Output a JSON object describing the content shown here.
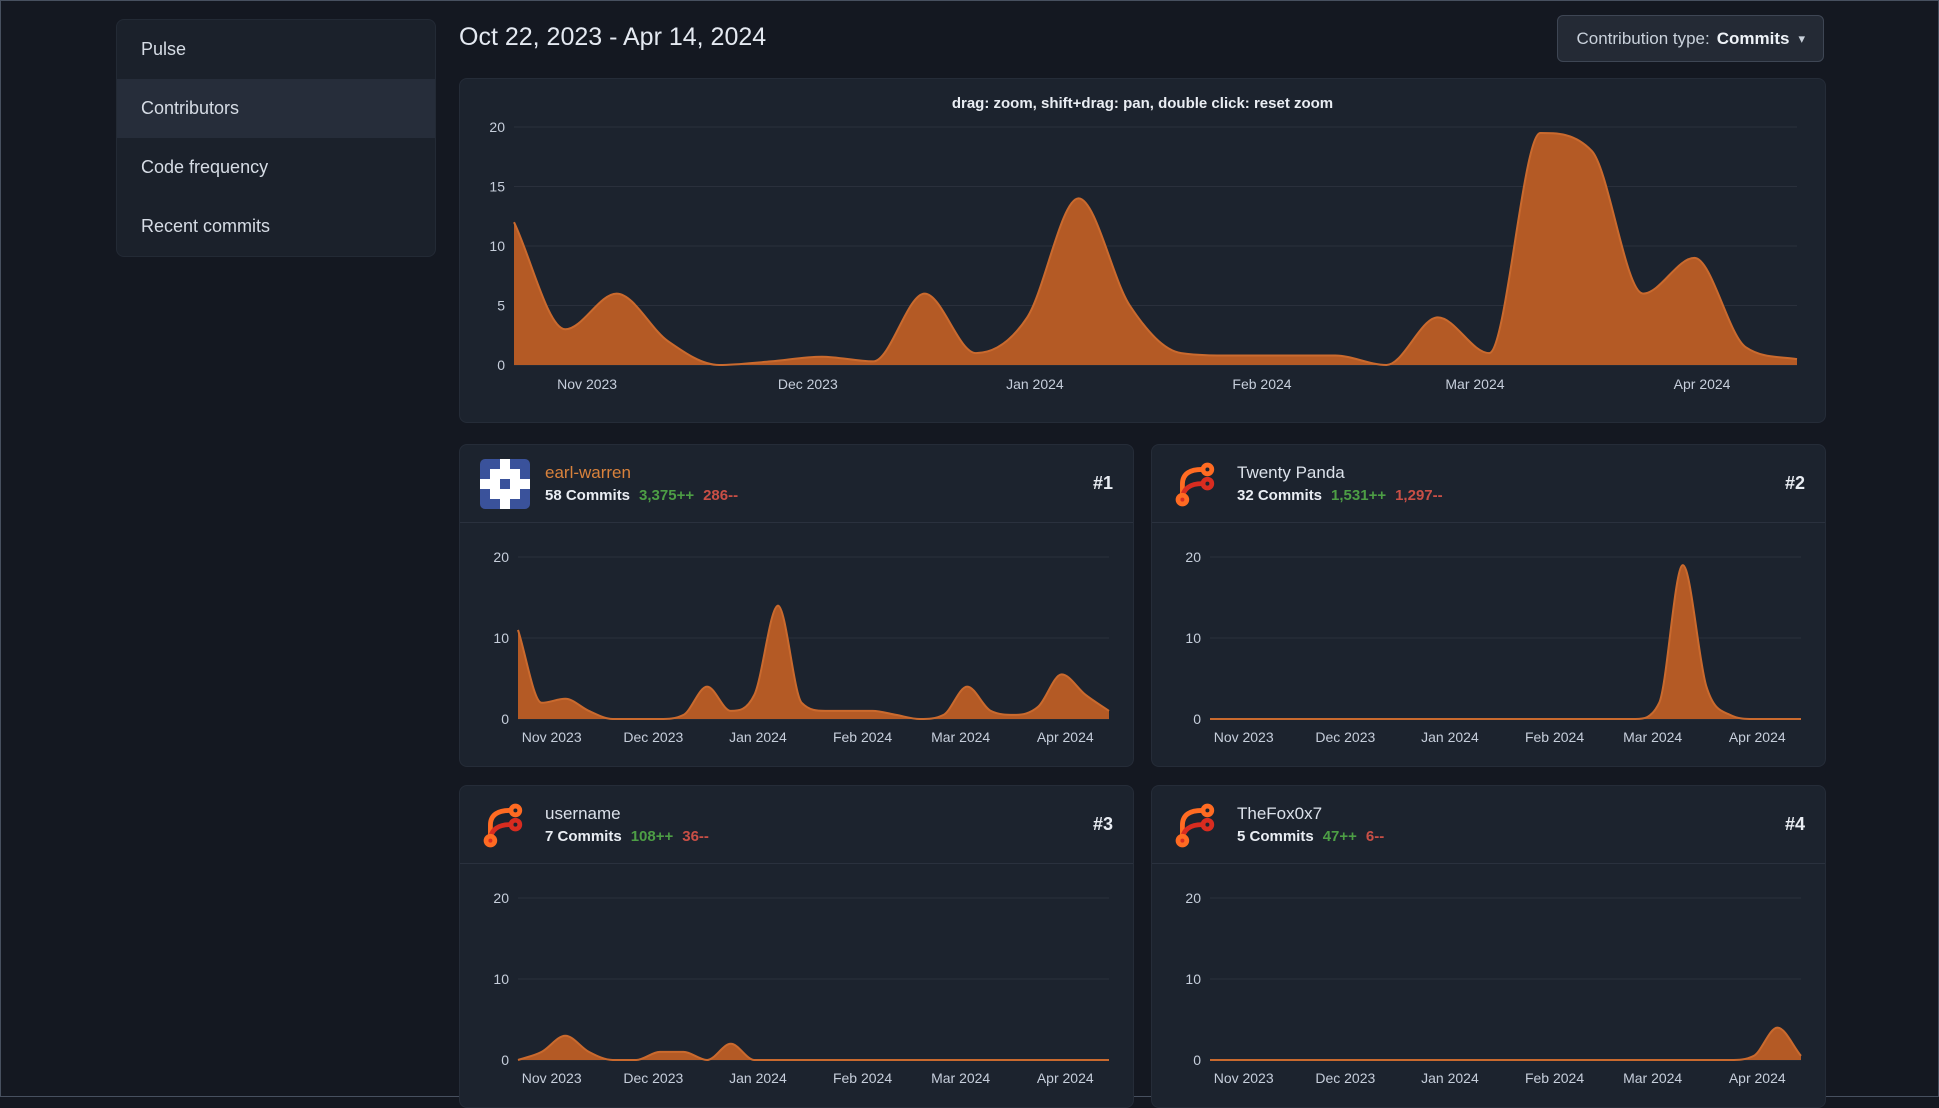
{
  "sidebar": {
    "items": [
      {
        "label": "Pulse",
        "active": false
      },
      {
        "label": "Contributors",
        "active": true
      },
      {
        "label": "Code frequency",
        "active": false
      },
      {
        "label": "Recent commits",
        "active": false
      }
    ]
  },
  "header": {
    "date_range": "Oct 22, 2023 - Apr 14, 2024",
    "contribution_type_label": "Contribution type:",
    "contribution_type_value": "Commits",
    "dropdown_caret": "▾"
  },
  "chart_axes": {
    "x_range_start": "Oct 22, 2023",
    "x_range_end": "Apr 14, 2024",
    "x_interval": "weekly",
    "ylim": [
      0,
      20
    ],
    "grid": "horizontal",
    "xticks": [
      {
        "label": "Nov 2023",
        "pos": 0.057
      },
      {
        "label": "Dec 2023",
        "pos": 0.229
      },
      {
        "label": "Jan 2024",
        "pos": 0.406
      },
      {
        "label": "Feb 2024",
        "pos": 0.583
      },
      {
        "label": "Mar 2024",
        "pos": 0.749
      },
      {
        "label": "Apr 2024",
        "pos": 0.926
      }
    ]
  },
  "chart_data": [
    {
      "name": "overall-commits",
      "type": "area",
      "title": "drag: zoom, shift+drag: pan, double click: reset zoom",
      "yticks": [
        0,
        5,
        10,
        15,
        20
      ],
      "values": [
        12,
        3,
        6,
        2,
        0,
        0.3,
        0.7,
        0.3,
        6,
        1,
        4,
        14,
        5,
        1,
        0.8,
        0.8,
        0.8,
        0,
        4,
        1,
        19.5,
        18,
        6,
        9,
        1.5,
        0.5
      ]
    },
    {
      "name": "earl-warren-commits",
      "type": "area",
      "yticks": [
        0,
        10,
        20
      ],
      "values": [
        11,
        2,
        2.5,
        1,
        0,
        0,
        0,
        0.5,
        4,
        1,
        3,
        14,
        2,
        1,
        1,
        1,
        0.5,
        0,
        0.5,
        4,
        1,
        0.5,
        1.5,
        5.5,
        3,
        1
      ]
    },
    {
      "name": "twenty-panda-commits",
      "type": "area",
      "yticks": [
        0,
        10,
        20
      ],
      "values": [
        0,
        0,
        0,
        0,
        0,
        0,
        0,
        0,
        0,
        0,
        0,
        0,
        0,
        0,
        0,
        0,
        0,
        0,
        0,
        2,
        19,
        4,
        0.5,
        0,
        0,
        0
      ]
    },
    {
      "name": "username-commits",
      "type": "area",
      "yticks": [
        0,
        10,
        20
      ],
      "values": [
        0,
        1,
        3,
        1,
        0,
        0,
        1,
        1,
        0,
        2,
        0,
        0,
        0,
        0,
        0,
        0,
        0,
        0,
        0,
        0,
        0,
        0,
        0,
        0,
        0,
        0
      ]
    },
    {
      "name": "thefox0x7-commits",
      "type": "area",
      "yticks": [
        0,
        10,
        20
      ],
      "values": [
        0,
        0,
        0,
        0,
        0,
        0,
        0,
        0,
        0,
        0,
        0,
        0,
        0,
        0,
        0,
        0,
        0,
        0,
        0,
        0,
        0,
        0,
        0,
        0.5,
        4,
        0.5
      ]
    }
  ],
  "contributors": [
    {
      "rank": "#1",
      "name": "earl-warren",
      "name_color": "#d9823c",
      "commits": "58 Commits",
      "additions": "3,375++",
      "deletions": "286--",
      "chart": 1,
      "avatar": {
        "type": "identicon",
        "bg": "#3a529b",
        "fg": "#ffffff",
        "pattern": [
          "00100",
          "01110",
          "11011",
          "01110",
          "00100"
        ]
      }
    },
    {
      "rank": "#2",
      "name": "Twenty Panda",
      "name_color": "#dbe1ea",
      "commits": "32 Commits",
      "additions": "1,531++",
      "deletions": "1,297--",
      "chart": 2,
      "avatar": {
        "type": "forgejo-logo",
        "orange": "#ff6b22",
        "red": "#d82c20"
      }
    },
    {
      "rank": "#3",
      "name": "username",
      "name_color": "#dbe1ea",
      "commits": "7 Commits",
      "additions": "108++",
      "deletions": "36--",
      "chart": 3,
      "avatar": {
        "type": "forgejo-logo",
        "orange": "#ff6b22",
        "red": "#d82c20"
      }
    },
    {
      "rank": "#4",
      "name": "TheFox0x7",
      "name_color": "#dbe1ea",
      "commits": "5 Commits",
      "additions": "47++",
      "deletions": "6--",
      "chart": 4,
      "avatar": {
        "type": "forgejo-logo",
        "orange": "#ff6b22",
        "red": "#d82c20"
      }
    }
  ],
  "colors": {
    "page_bg": "#141821",
    "panel_bg": "#1c232e",
    "chart_fill": "#b45a25",
    "chart_line": "#ca6a2e",
    "grid": "#2a303c",
    "axis_text": "#c6cedb",
    "additions": "#4d9e45",
    "deletions": "#c94f46",
    "link_orange": "#d9823c"
  }
}
